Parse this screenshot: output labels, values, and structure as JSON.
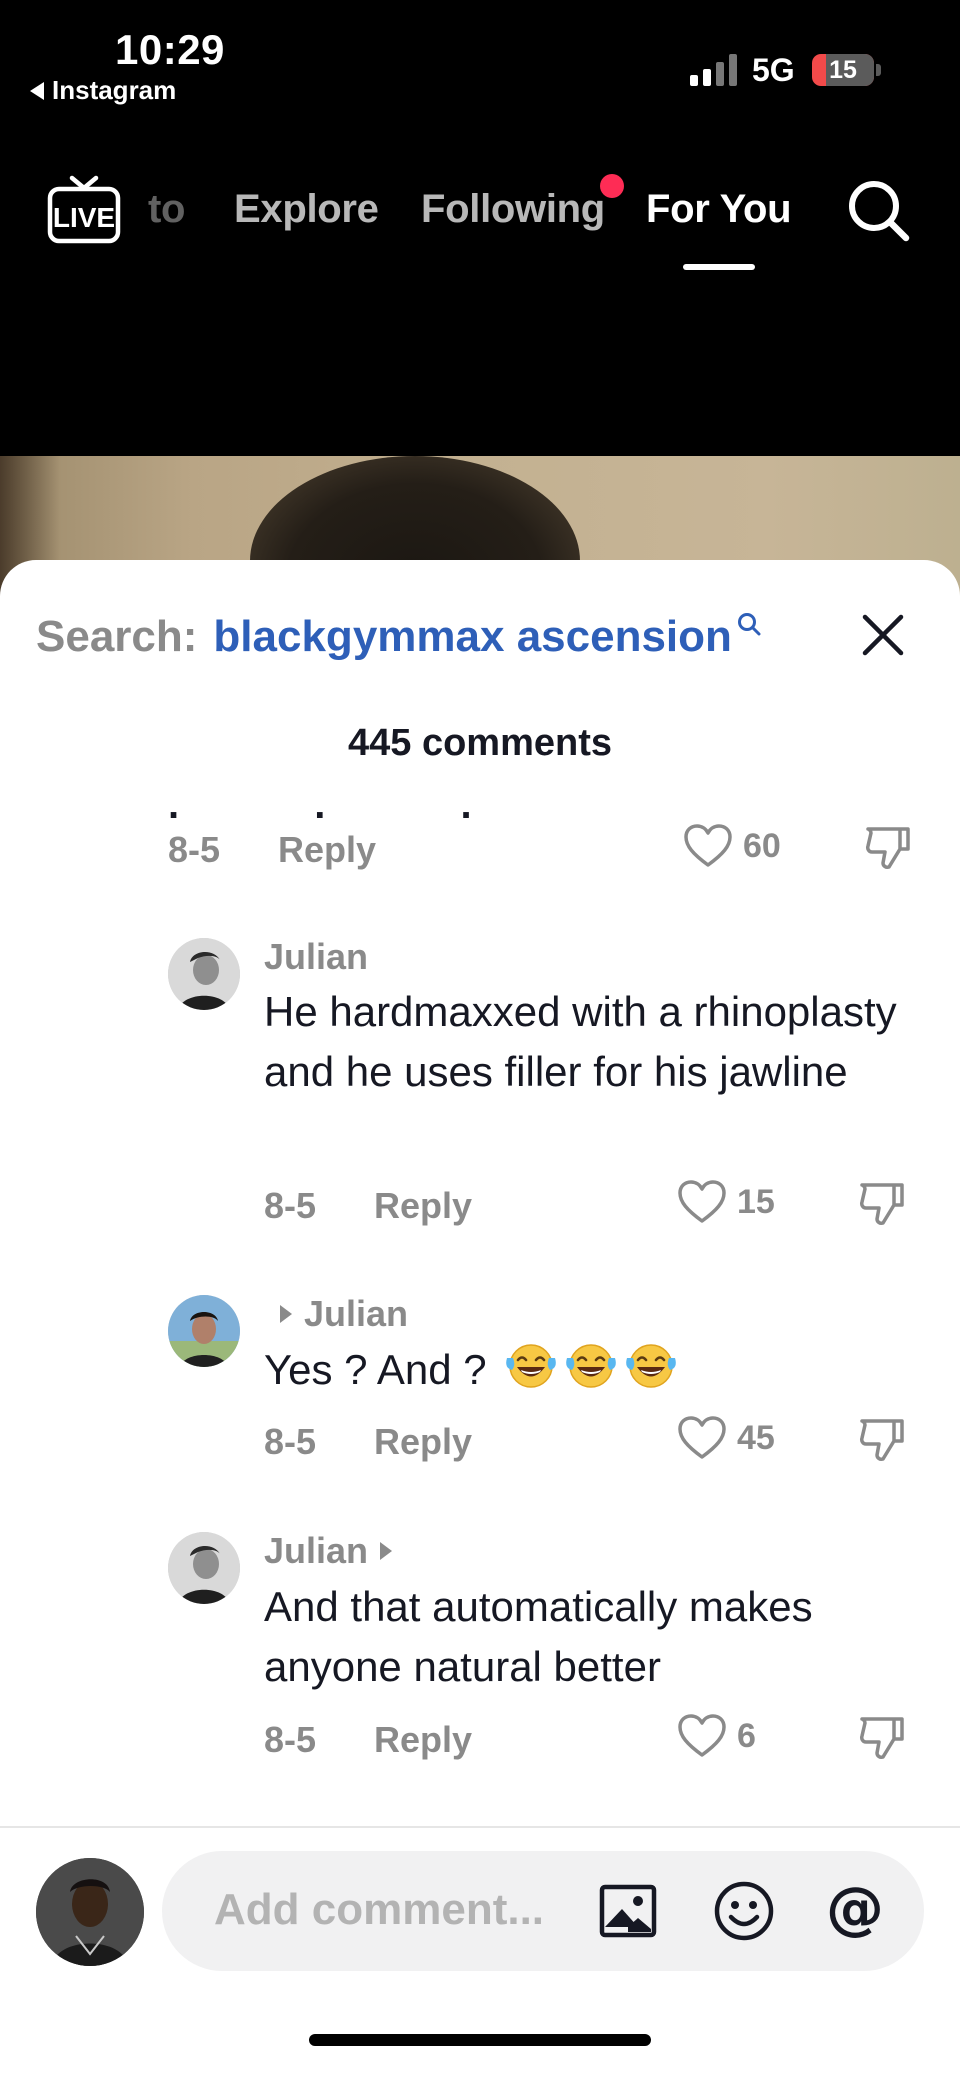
{
  "status_bar": {
    "time": "10:29",
    "back_app": "Instagram",
    "network": "5G",
    "battery": "15"
  },
  "top_nav": {
    "live_label": "LIVE",
    "tabs": [
      {
        "label": "to",
        "active": false
      },
      {
        "label": "Explore",
        "active": false
      },
      {
        "label": "Following",
        "active": false,
        "has_dot": true
      },
      {
        "label": "For You",
        "active": true
      }
    ]
  },
  "sheet": {
    "search_label": "Search:",
    "search_term": "blackgymmax ascension",
    "comments_count": "445 comments"
  },
  "comments": {
    "truncated_text": ". . .",
    "first_meta": {
      "date": "8-5",
      "reply": "Reply",
      "likes": "60"
    },
    "items": [
      {
        "username": "Julian",
        "text": "He hardmaxxed with a rhinoplasty and he uses filler for his jawline",
        "date": "8-5",
        "reply": "Reply",
        "likes": "15"
      },
      {
        "username": "Julian",
        "text": "Yes ? And ?",
        "emoji": [
          "laughing-crying",
          "laughing-crying",
          "laughing-crying"
        ],
        "date": "8-5",
        "reply": "Reply",
        "likes": "45"
      },
      {
        "username": "Julian",
        "text": "And that automatically makes anyone natural better",
        "date": "8-5",
        "reply": "Reply",
        "likes": "6"
      }
    ]
  },
  "composer": {
    "placeholder": "Add comment...",
    "mention_symbol": "@"
  },
  "colors": {
    "link_blue": "#2e5fb8",
    "muted_gray": "#8a8a8a",
    "text_dark": "#161823",
    "notification_red": "#fe2c55",
    "input_bg": "#f1f1f2"
  }
}
